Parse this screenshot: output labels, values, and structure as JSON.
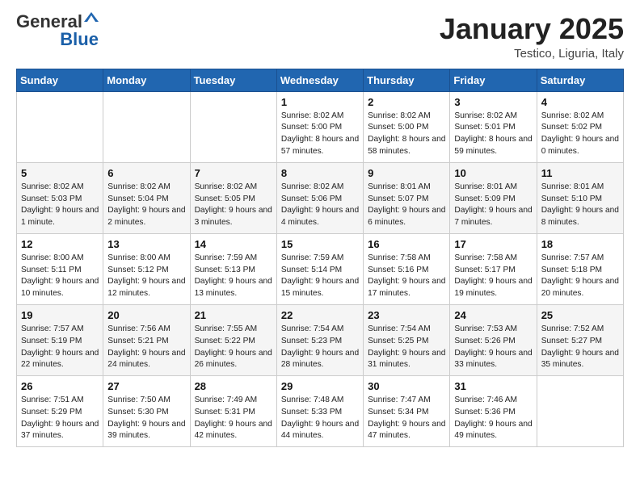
{
  "header": {
    "logo_general": "General",
    "logo_blue": "Blue",
    "month_title": "January 2025",
    "location": "Testico, Liguria, Italy"
  },
  "weekdays": [
    "Sunday",
    "Monday",
    "Tuesday",
    "Wednesday",
    "Thursday",
    "Friday",
    "Saturday"
  ],
  "weeks": [
    [
      {
        "day": "",
        "info": ""
      },
      {
        "day": "",
        "info": ""
      },
      {
        "day": "",
        "info": ""
      },
      {
        "day": "1",
        "info": "Sunrise: 8:02 AM\nSunset: 5:00 PM\nDaylight: 8 hours and 57 minutes."
      },
      {
        "day": "2",
        "info": "Sunrise: 8:02 AM\nSunset: 5:00 PM\nDaylight: 8 hours and 58 minutes."
      },
      {
        "day": "3",
        "info": "Sunrise: 8:02 AM\nSunset: 5:01 PM\nDaylight: 8 hours and 59 minutes."
      },
      {
        "day": "4",
        "info": "Sunrise: 8:02 AM\nSunset: 5:02 PM\nDaylight: 9 hours and 0 minutes."
      }
    ],
    [
      {
        "day": "5",
        "info": "Sunrise: 8:02 AM\nSunset: 5:03 PM\nDaylight: 9 hours and 1 minute."
      },
      {
        "day": "6",
        "info": "Sunrise: 8:02 AM\nSunset: 5:04 PM\nDaylight: 9 hours and 2 minutes."
      },
      {
        "day": "7",
        "info": "Sunrise: 8:02 AM\nSunset: 5:05 PM\nDaylight: 9 hours and 3 minutes."
      },
      {
        "day": "8",
        "info": "Sunrise: 8:02 AM\nSunset: 5:06 PM\nDaylight: 9 hours and 4 minutes."
      },
      {
        "day": "9",
        "info": "Sunrise: 8:01 AM\nSunset: 5:07 PM\nDaylight: 9 hours and 6 minutes."
      },
      {
        "day": "10",
        "info": "Sunrise: 8:01 AM\nSunset: 5:09 PM\nDaylight: 9 hours and 7 minutes."
      },
      {
        "day": "11",
        "info": "Sunrise: 8:01 AM\nSunset: 5:10 PM\nDaylight: 9 hours and 8 minutes."
      }
    ],
    [
      {
        "day": "12",
        "info": "Sunrise: 8:00 AM\nSunset: 5:11 PM\nDaylight: 9 hours and 10 minutes."
      },
      {
        "day": "13",
        "info": "Sunrise: 8:00 AM\nSunset: 5:12 PM\nDaylight: 9 hours and 12 minutes."
      },
      {
        "day": "14",
        "info": "Sunrise: 7:59 AM\nSunset: 5:13 PM\nDaylight: 9 hours and 13 minutes."
      },
      {
        "day": "15",
        "info": "Sunrise: 7:59 AM\nSunset: 5:14 PM\nDaylight: 9 hours and 15 minutes."
      },
      {
        "day": "16",
        "info": "Sunrise: 7:58 AM\nSunset: 5:16 PM\nDaylight: 9 hours and 17 minutes."
      },
      {
        "day": "17",
        "info": "Sunrise: 7:58 AM\nSunset: 5:17 PM\nDaylight: 9 hours and 19 minutes."
      },
      {
        "day": "18",
        "info": "Sunrise: 7:57 AM\nSunset: 5:18 PM\nDaylight: 9 hours and 20 minutes."
      }
    ],
    [
      {
        "day": "19",
        "info": "Sunrise: 7:57 AM\nSunset: 5:19 PM\nDaylight: 9 hours and 22 minutes."
      },
      {
        "day": "20",
        "info": "Sunrise: 7:56 AM\nSunset: 5:21 PM\nDaylight: 9 hours and 24 minutes."
      },
      {
        "day": "21",
        "info": "Sunrise: 7:55 AM\nSunset: 5:22 PM\nDaylight: 9 hours and 26 minutes."
      },
      {
        "day": "22",
        "info": "Sunrise: 7:54 AM\nSunset: 5:23 PM\nDaylight: 9 hours and 28 minutes."
      },
      {
        "day": "23",
        "info": "Sunrise: 7:54 AM\nSunset: 5:25 PM\nDaylight: 9 hours and 31 minutes."
      },
      {
        "day": "24",
        "info": "Sunrise: 7:53 AM\nSunset: 5:26 PM\nDaylight: 9 hours and 33 minutes."
      },
      {
        "day": "25",
        "info": "Sunrise: 7:52 AM\nSunset: 5:27 PM\nDaylight: 9 hours and 35 minutes."
      }
    ],
    [
      {
        "day": "26",
        "info": "Sunrise: 7:51 AM\nSunset: 5:29 PM\nDaylight: 9 hours and 37 minutes."
      },
      {
        "day": "27",
        "info": "Sunrise: 7:50 AM\nSunset: 5:30 PM\nDaylight: 9 hours and 39 minutes."
      },
      {
        "day": "28",
        "info": "Sunrise: 7:49 AM\nSunset: 5:31 PM\nDaylight: 9 hours and 42 minutes."
      },
      {
        "day": "29",
        "info": "Sunrise: 7:48 AM\nSunset: 5:33 PM\nDaylight: 9 hours and 44 minutes."
      },
      {
        "day": "30",
        "info": "Sunrise: 7:47 AM\nSunset: 5:34 PM\nDaylight: 9 hours and 47 minutes."
      },
      {
        "day": "31",
        "info": "Sunrise: 7:46 AM\nSunset: 5:36 PM\nDaylight: 9 hours and 49 minutes."
      },
      {
        "day": "",
        "info": ""
      }
    ]
  ]
}
